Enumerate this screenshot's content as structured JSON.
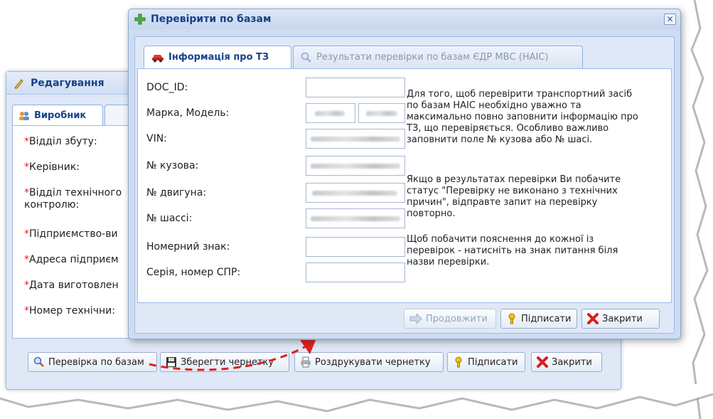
{
  "background_window": {
    "title": "Редагування",
    "tab_label": "Виробник",
    "fields": [
      {
        "label": "Відділ збуту:"
      },
      {
        "label": "Керівник:"
      },
      {
        "label": "Відділ технічного контролю:"
      },
      {
        "label": "Підприємство-ви"
      },
      {
        "label": "Адреса підприєм"
      },
      {
        "label": "Дата виготовлен"
      },
      {
        "label": "Номер технічни:"
      }
    ],
    "required_mark": "*",
    "buttons": {
      "check": "Перевірка по базам",
      "save_draft": "Зберегти чернетку",
      "print_draft": "Роздрукувати чернетку",
      "sign": "Підписати",
      "close": "Закрити"
    }
  },
  "dialog": {
    "title": "Перевірити по базам",
    "close_glyph": "✕",
    "tabs": [
      {
        "label": "Інформація про ТЗ",
        "active": true
      },
      {
        "label": "Результати перевірки по базам ЄДР МВС (НАІС)",
        "active": false
      }
    ],
    "fields": {
      "doc_id": "DOC_ID:",
      "brand_model": "Марка, Модель:",
      "vin": "VIN:",
      "body_no": "№ кузова:",
      "engine_no": "№ двигуна:",
      "chassis_no": "№ шассі:",
      "plate": "Номерний знак:",
      "spr": "Серія, номер СПР:"
    },
    "help": {
      "p1": "Для того, щоб перевірити транспортний засіб по базам НАІС необхідно уважно та максимально повно заповнити інформацію про ТЗ, що перевіряється. Особливо важливо заповнити поле № кузова або № шасі.",
      "p2": "Якщо в результатах перевірки Ви побачите статус \"Перевірку не виконано з технічних причин\", відправте запит на перевірку повторно.",
      "p3": "Щоб побачити пояснення до кожної із перевірок - натисніть на знак питання біля назви перевірки."
    },
    "buttons": {
      "continue": "Продовжити",
      "sign": "Підписати",
      "close": "Закрити"
    }
  },
  "colors": {
    "title_blue": "#15428b",
    "required_red": "#e02020",
    "annotation_red": "#e02020"
  }
}
